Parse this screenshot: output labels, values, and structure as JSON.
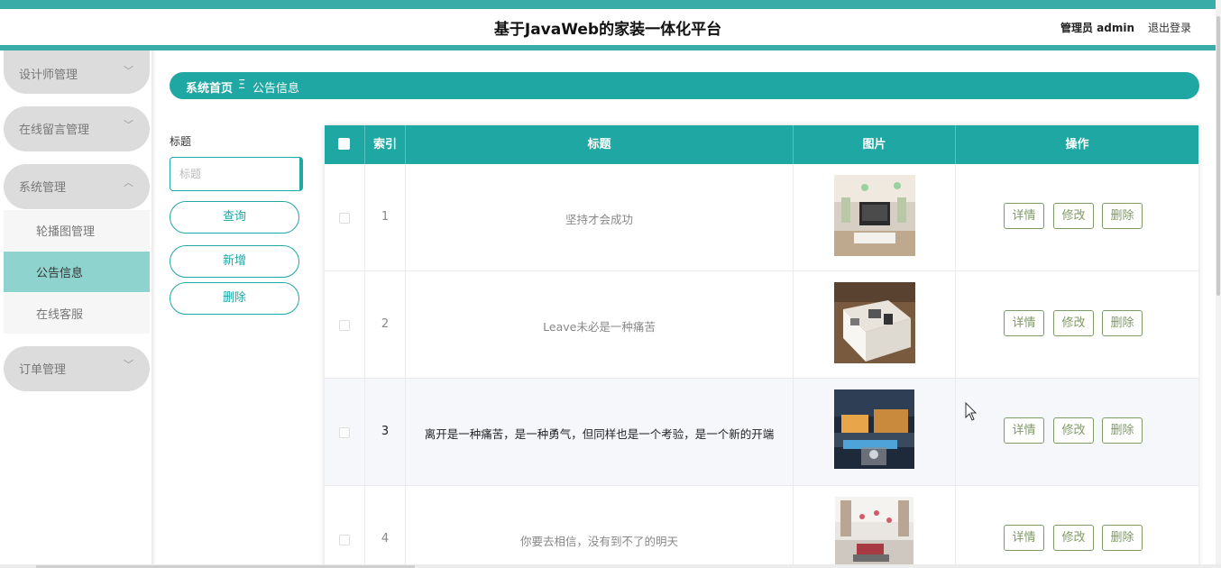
{
  "header": {
    "title": "基于JavaWeb的家装一体化平台",
    "admin": "管理员 admin",
    "logout": "退出登录"
  },
  "sidebar": {
    "menus": [
      {
        "label": "设计师管理",
        "chevron": "chevron-down-icon"
      },
      {
        "label": "在线留言管理",
        "chevron": "chevron-down-icon"
      },
      {
        "label": "系统管理",
        "chevron": "chevron-up-icon"
      },
      {
        "label": "订单管理",
        "chevron": "chevron-down-icon"
      }
    ],
    "submenu": [
      {
        "label": "轮播图管理",
        "active": false
      },
      {
        "label": "公告信息",
        "active": true
      },
      {
        "label": "在线客服",
        "active": false
      }
    ]
  },
  "breadcrumb": {
    "home": "系统首页",
    "separator": "Ξ",
    "current": "公告信息"
  },
  "search": {
    "label": "标题",
    "placeholder": "标题",
    "value": ""
  },
  "buttons": {
    "query": "查询",
    "add": "新增",
    "delete": "删除"
  },
  "table": {
    "columns": [
      "索引",
      "标题",
      "图片",
      "操作"
    ],
    "rows": [
      {
        "index": "1",
        "title": "坚持才会成功",
        "image": "living-room-tv-wall-photo"
      },
      {
        "index": "2",
        "title": "Leave未必是一种痛苦",
        "image": "cutaway-room-model-photo"
      },
      {
        "index": "3",
        "title": "离开是一种痛苦，是一种勇气，但同样也是一个考验，是一个新的开端",
        "image": "night-villa-exterior-photo"
      },
      {
        "index": "4",
        "title": "你要去相信，没有到不了的明天",
        "image": "bright-living-room-photo"
      }
    ],
    "actions": {
      "detail": "详情",
      "edit": "修改",
      "delete": "删除"
    }
  },
  "colors": {
    "accent": "#1ea7a3",
    "stripe": "#3aaca8",
    "active_submenu": "#8fd3cf",
    "action_button": "#7f9a66"
  }
}
